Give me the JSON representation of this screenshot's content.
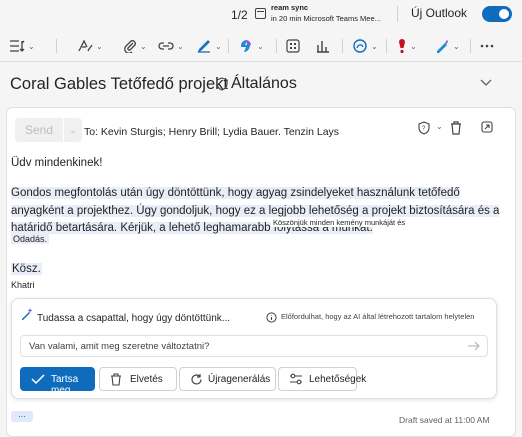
{
  "topbar": {
    "pager": "1/2",
    "reminder_title": "ream sync",
    "reminder_detail": "in 20 min Microsoft Teams Mee...",
    "new_outlook_label": "Új Outlook",
    "new_outlook_on": true
  },
  "ribbon": {
    "tools": [
      "format-icon",
      "paint-icon",
      "attach-icon",
      "link-icon",
      "sign-icon",
      "copilot-icon",
      "apps-icon",
      "chart-icon",
      "loop-icon",
      "importance-icon",
      "sensitivity-icon",
      "more-icon"
    ]
  },
  "subject": {
    "title": "Coral Gables Tetőfedő projekt",
    "channel": "Általános"
  },
  "compose": {
    "send_label": "Send",
    "to_line": "To: Kevin Sturgis; Henry Brill; Lydia Bauer. Tenzin Lays",
    "greeting": "Üdv mindenkinek!",
    "paragraph": "Gondos megfontolás után úgy döntöttünk, hogy agyag zsindelyeket használunk tetőfedő anyagként a projekthez. Úgy gondoljuk, hogy ez a legjobb lehetőség a projekt biztosítására és a határidő betartására. Kérjük, a lehető leghamarabb folytassa a munkát.",
    "overlay_tip": "Köszönjük minden kemény munkáját és",
    "overlay_tip2": "Odadás.",
    "closing": "Kösz.",
    "signature": "Khatri"
  },
  "copilot": {
    "prompt_text": "Tudassa a csapattal, hogy úgy döntöttünk...",
    "disclaimer": "Előfordulhat, hogy az AI által létrehozott tartalom helytelen",
    "input_placeholder": "Van valami, amit meg szeretne változtatni?",
    "keep_label": "Tartsa meg",
    "discard_label": "Elvetés",
    "regenerate_label": "Újragenerálás",
    "options_label": "Lehetőségek"
  },
  "footer": {
    "more_label": "...",
    "draft_status": "Draft saved at 11:00 AM"
  },
  "colors": {
    "accent": "#0f6cbd",
    "highlight": "#e8edf7",
    "background": "#f5f5f5"
  }
}
